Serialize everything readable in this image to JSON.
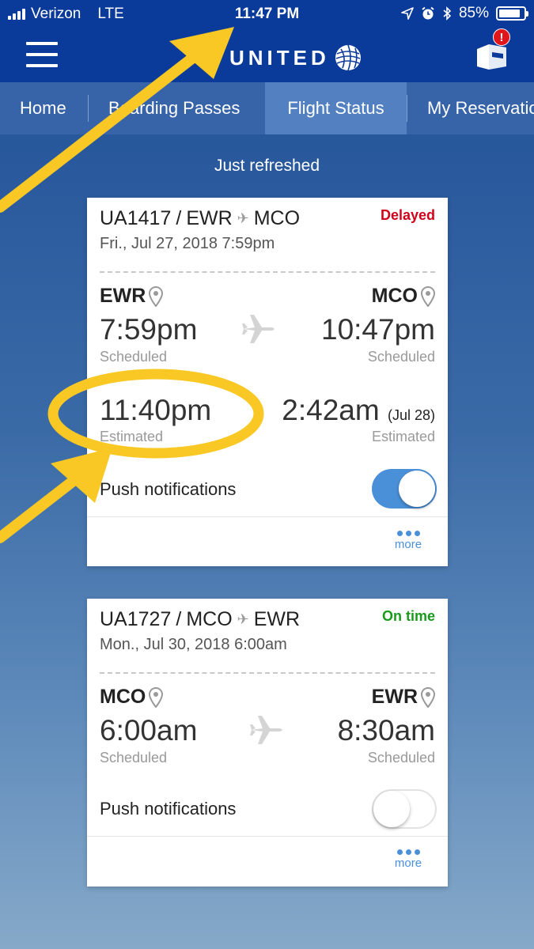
{
  "status_bar": {
    "carrier": "Verizon",
    "network": "LTE",
    "time": "11:47 PM",
    "battery": "85%",
    "battery_level": 0.85,
    "icons": [
      "location-arrow-icon",
      "alarm-icon",
      "bluetooth-icon"
    ]
  },
  "header": {
    "logo_text": "UNITED",
    "menu_icon": "hamburger-menu-icon",
    "passbook_icon": "passbook-wallet-icon",
    "badge": "!"
  },
  "tabs": [
    {
      "label": "Home",
      "active": false
    },
    {
      "label": "Boarding Passes",
      "active": false
    },
    {
      "label": "Flight Status",
      "active": true
    },
    {
      "label": "My Reservations",
      "active": false
    }
  ],
  "refresh_text": "Just refreshed",
  "flights": [
    {
      "flight_number": "UA1417",
      "origin": "EWR",
      "destination": "MCO",
      "status": "Delayed",
      "status_color": "#d0021b",
      "date": "Fri., Jul 27, 2018  7:59pm",
      "scheduled_departure": "7:59pm",
      "scheduled_arrival": "10:47pm",
      "scheduled_label": "Scheduled",
      "estimated_departure": "11:40pm",
      "estimated_arrival": "2:42am",
      "estimated_arrival_note": "(Jul 28)",
      "estimated_label": "Estimated",
      "push_label": "Push notifications",
      "push_enabled": true,
      "more_label": "more"
    },
    {
      "flight_number": "UA1727",
      "origin": "MCO",
      "destination": "EWR",
      "status": "On time",
      "status_color": "#1a9a1a",
      "date": "Mon., Jul 30, 2018  6:00am",
      "scheduled_departure": "6:00am",
      "scheduled_arrival": "8:30am",
      "scheduled_label": "Scheduled",
      "push_label": "Push notifications",
      "push_enabled": false,
      "more_label": "more"
    }
  ],
  "annotation_color": "#f9c824"
}
